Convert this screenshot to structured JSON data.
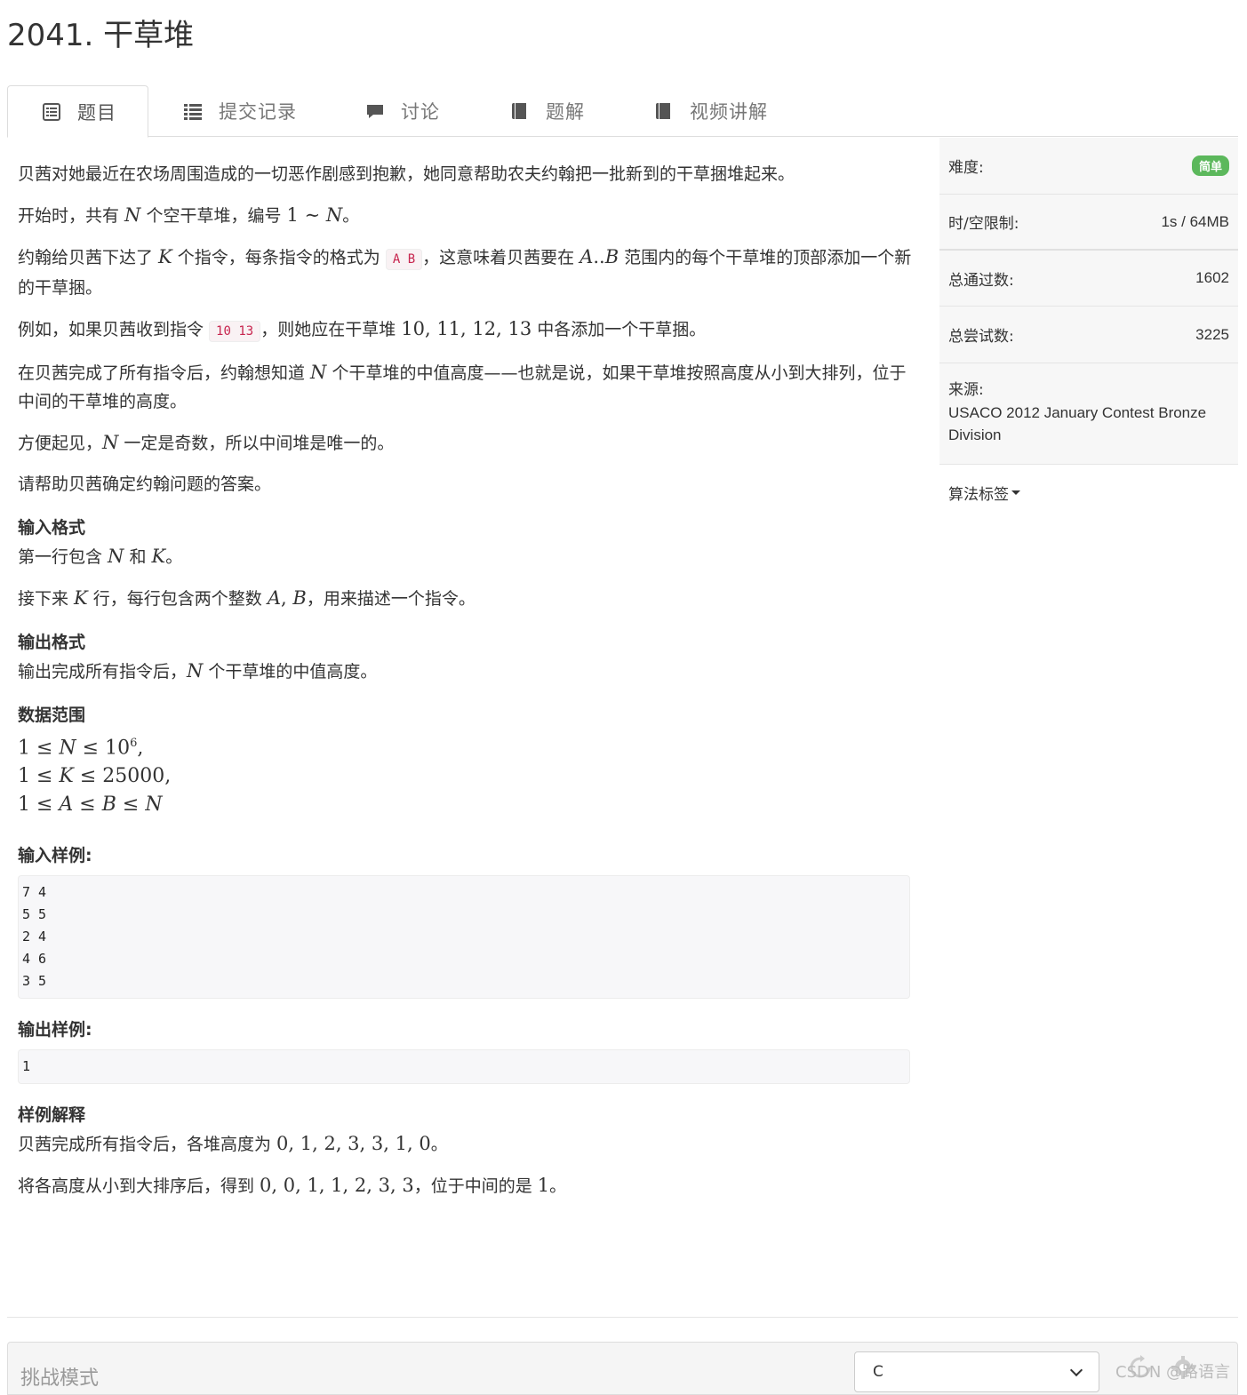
{
  "problem": {
    "title": "2041. 干草堆"
  },
  "tabs": [
    {
      "label": "题目",
      "icon": "list-alt-icon"
    },
    {
      "label": "提交记录",
      "icon": "list-icon"
    },
    {
      "label": "讨论",
      "icon": "comment-icon"
    },
    {
      "label": "题解",
      "icon": "book-icon"
    },
    {
      "label": "视频讲解",
      "icon": "book-icon"
    }
  ],
  "description": {
    "p1": "贝茜对她最近在农场周围造成的一切恶作剧感到抱歉，她同意帮助农夫约翰把一批新到的干草捆堆起来。",
    "p2_a": "开始时，共有 ",
    "p2_b": " 个空干草堆，编号 ",
    "p2_c": "。",
    "p3_a": "约翰给贝茜下达了 ",
    "p3_b": " 个指令，每条指令的格式为 ",
    "p3_code": "A B",
    "p3_c": "，这意味着贝茜要在 ",
    "p3_d": " 范围内的每个干草堆的顶部添加一个新的干草捆。",
    "p4_a": "例如，如果贝茜收到指令 ",
    "p4_code": "10 13",
    "p4_b": "，则她应在干草堆 ",
    "p4_math": "10, 11, 12, 13",
    "p4_c": " 中各添加一个干草捆。",
    "p5_a": "在贝茜完成了所有指令后，约翰想知道 ",
    "p5_b": " 个干草堆的中值高度——也就是说，如果干草堆按照高度从小到大排列，位于中间的干草堆的高度。",
    "p6_a": "方便起见，",
    "p6_b": " 一定是奇数，所以中间堆是唯一的。",
    "p7": "请帮助贝茜确定约翰问题的答案。"
  },
  "math": {
    "N": "N",
    "K": "K",
    "A": "A",
    "B": "B",
    "one": "1",
    "tilde": " ∼ ",
    "dots": "..",
    "comma": ", "
  },
  "input_format": {
    "heading": "输入格式",
    "l1_a": "第一行包含 ",
    "l1_b": " 和 ",
    "l1_c": "。",
    "l2_a": "接下来 ",
    "l2_b": " 行，每行包含两个整数 ",
    "l2_c": "，用来描述一个指令。"
  },
  "output_format": {
    "heading": "输出格式",
    "l1_a": "输出完成所有指令后，",
    "l1_b": " 个干草堆的中值高度。"
  },
  "data_range": {
    "heading": "数据范围",
    "r1_a": "1 ≤ ",
    "r1_b": " ≤ 10",
    "r1_sup": "6",
    "r1_c": ",",
    "r2_a": "1 ≤ ",
    "r2_b": " ≤ 25000,",
    "r3_a": "1 ≤ ",
    "r3_b": " ≤ ",
    "r3_c": " ≤ "
  },
  "sample_input": {
    "heading": "输入样例:",
    "lines": [
      "7 4",
      "5 5",
      "2 4",
      "4 6",
      "3 5"
    ]
  },
  "sample_output": {
    "heading": "输出样例:",
    "lines": [
      "1"
    ]
  },
  "explanation": {
    "heading": "样例解释",
    "l1_a": "贝茜完成所有指令后，各堆高度为 ",
    "l1_math": "0, 1, 2, 3, 3, 1, 0",
    "l1_b": "。",
    "l2_a": "将各高度从小到大排序后，得到 ",
    "l2_math": "0, 0, 1, 1, 2, 3, 3",
    "l2_b": "，位于中间的是 ",
    "l2_math2": "1",
    "l2_c": "。"
  },
  "sidebar": {
    "difficulty_label": "难度:",
    "difficulty_value": "简单",
    "limit_label": "时/空限制:",
    "limit_value": "1s / 64MB",
    "passed_label": "总通过数:",
    "passed_value": "1602",
    "tried_label": "总尝试数:",
    "tried_value": "3225",
    "source_label": "来源:",
    "source_value": "USACO 2012 January Contest Bronze Division",
    "tags_label": "算法标签"
  },
  "editor": {
    "mode_label": "挑战模式",
    "language": "C"
  },
  "watermark": "CSDN @路语言",
  "colors": {
    "badge": "#5cb85c",
    "code_text": "#c7254e",
    "code_bg": "#f9f2f4"
  }
}
